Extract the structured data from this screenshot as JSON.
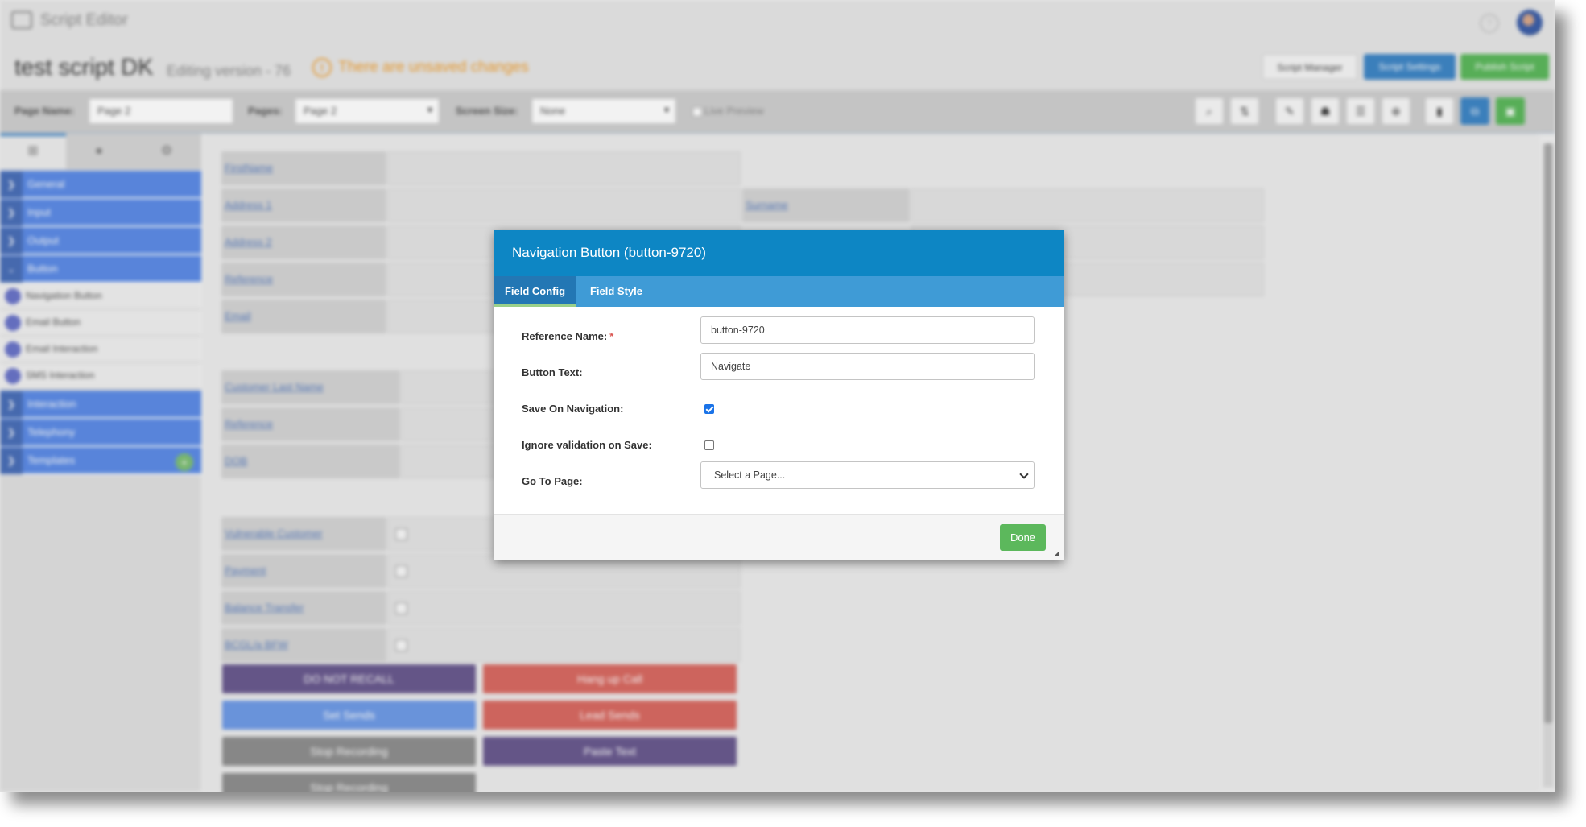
{
  "app": {
    "title": "Script Editor",
    "help_glyph": "?"
  },
  "header": {
    "script_name": "test script DK",
    "version_label": "Editing version - 76",
    "unsaved_icon_glyph": "!",
    "unsaved_text": "There are unsaved changes",
    "buttons": {
      "script_manager": "Script Manager",
      "script_settings": "Script Settings",
      "publish_script": "Publish Script"
    },
    "colors": {
      "warning": "#f0a030",
      "primary": "#3f86c6",
      "success": "#5cb85c"
    }
  },
  "toolbar": {
    "page_name_label": "Page Name:",
    "page_name_value": "Page 2",
    "pages_label": "Pages:",
    "pages_value": "Page 2",
    "screen_size_label": "Screen Size:",
    "screen_size_value": "None",
    "live_preview_label": "Live Preview",
    "tools": [
      {
        "icon": "zoom-icon",
        "glyph": "⌕"
      },
      {
        "icon": "chart-icon",
        "glyph": "⇅"
      },
      {
        "icon": "tool-icon",
        "glyph": "✎"
      },
      {
        "icon": "people-icon",
        "glyph": "☗"
      },
      {
        "icon": "list-icon",
        "glyph": "☰"
      },
      {
        "icon": "target-icon",
        "glyph": "⊕"
      },
      {
        "icon": "document-icon",
        "glyph": "▮"
      },
      {
        "icon": "copy-icon",
        "glyph": "⧉"
      },
      {
        "icon": "save-icon",
        "glyph": "▣"
      }
    ]
  },
  "sidebar": {
    "tabs": [
      {
        "icon": "grid-icon",
        "glyph": "⊞"
      },
      {
        "icon": "circle-icon",
        "glyph": "●"
      },
      {
        "icon": "settings-icon",
        "glyph": "⚙"
      }
    ],
    "arrow_collapsed": "❯",
    "arrow_expanded": "⌄",
    "categories_top": [
      "General",
      "Input",
      "Output",
      "Button"
    ],
    "button_items": [
      "Navigation Button",
      "Email Button",
      "Email Interaction",
      "SMS Interaction"
    ],
    "categories_bottom": [
      "Interaction",
      "Telephony",
      "Templates"
    ],
    "add_glyph": "+"
  },
  "canvas": {
    "fields_group1": [
      "FirstName",
      "Address 1",
      "Address 2",
      "Reference",
      "Email"
    ],
    "surname_label": "Surname",
    "fields_group2": [
      "Customer Last Name",
      "Reference",
      "DOB"
    ],
    "fields_group3": [
      "Vulnerable Customer",
      "Payment",
      "Balance Transfer",
      "BCGL/a BFW"
    ],
    "buttons": [
      {
        "label": "DO NOT RECALL",
        "color": "#6a5a8f"
      },
      {
        "label": "Hang up Call",
        "color": "#d96a62"
      },
      {
        "label": "Set Sends",
        "color": "#6f9be6"
      },
      {
        "label": "Lead Sends",
        "color": "#d96a62"
      },
      {
        "label": "Stop Recording",
        "color": "#8f8f8f"
      },
      {
        "label": "Paste Text",
        "color": "#6a5a8f"
      },
      {
        "label": "Stop Recording",
        "color": "#8f8f8f"
      }
    ]
  },
  "dialog": {
    "title": "Navigation Button (button-9720)",
    "tabs": [
      "Field Config",
      "Field Style"
    ],
    "fields": {
      "reference_name_label": "Reference Name:",
      "required_marker": "*",
      "reference_name_value": "button-9720",
      "button_text_label": "Button Text:",
      "button_text_value": "Navigate",
      "save_on_navigation_label": "Save On Navigation:",
      "save_on_navigation_checked": true,
      "ignore_validation_label": "Ignore validation on Save:",
      "ignore_validation_checked": false,
      "go_to_page_label": "Go To Page:",
      "go_to_page_value": "Select a Page..."
    },
    "done_label": "Done",
    "colors": {
      "header": "#0d86c4",
      "tabs": "#3f9bd6",
      "active_tab": "#2377b4",
      "done": "#5cb85c"
    }
  }
}
